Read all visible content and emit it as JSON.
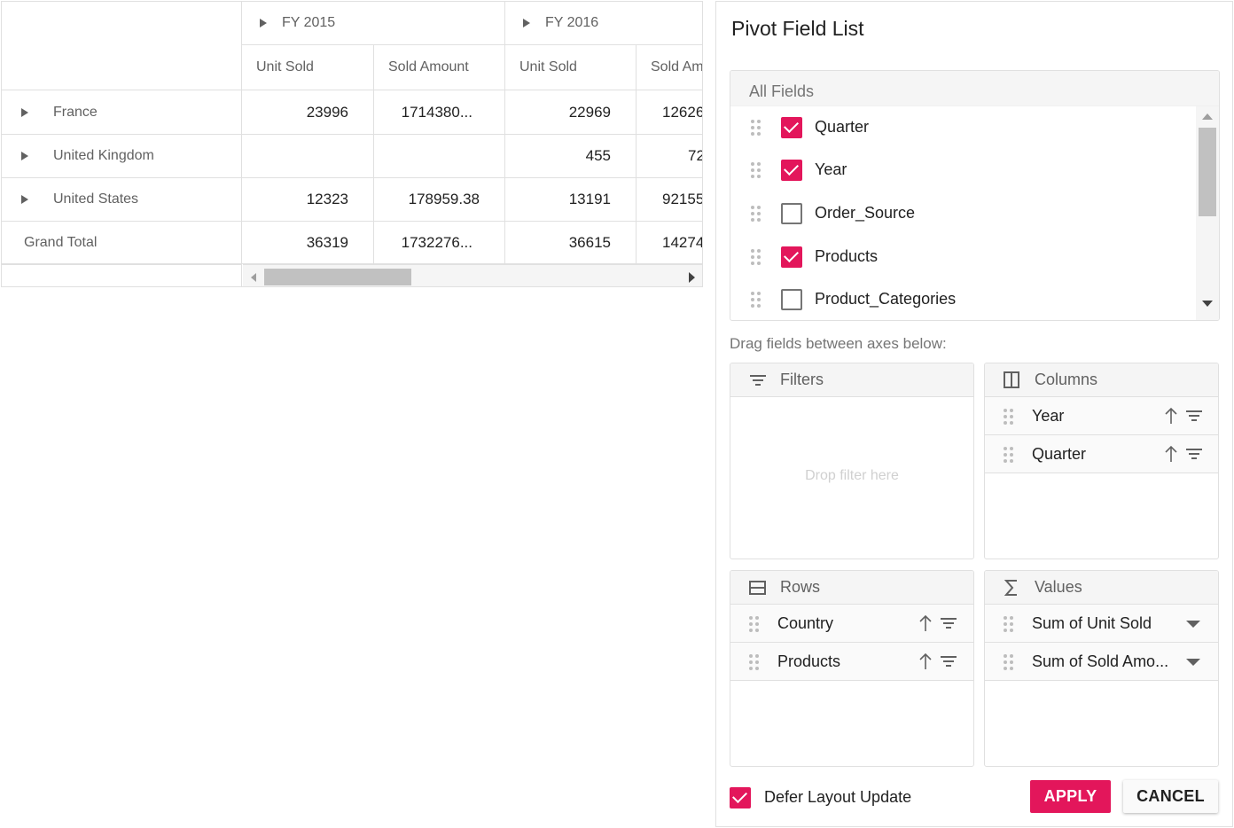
{
  "grid": {
    "column_groups": [
      {
        "label": "FY 2015"
      },
      {
        "label": "FY 2016"
      }
    ],
    "measures": [
      "Unit Sold",
      "Sold Amount",
      "Unit Sold",
      "Sold Am"
    ],
    "rows": [
      {
        "label": "France",
        "values": [
          "23996",
          "1714380...",
          "22969",
          "12626"
        ]
      },
      {
        "label": "United Kingdom",
        "values": [
          "",
          "",
          "455",
          "72"
        ]
      },
      {
        "label": "United States",
        "values": [
          "12323",
          "178959.38",
          "13191",
          "92155"
        ]
      },
      {
        "label": "Grand Total",
        "values": [
          "36319",
          "1732276...",
          "36615",
          "14274"
        ]
      }
    ]
  },
  "field_list": {
    "title": "Pivot Field List",
    "all_fields_header": "All Fields",
    "fields": [
      {
        "label": "Quarter",
        "checked": true
      },
      {
        "label": "Year",
        "checked": true
      },
      {
        "label": "Order_Source",
        "checked": false
      },
      {
        "label": "Products",
        "checked": true
      },
      {
        "label": "Product_Categories",
        "checked": false
      }
    ],
    "drag_hint": "Drag fields between axes below:",
    "filters": {
      "label": "Filters",
      "drop_hint": "Drop filter here",
      "icon": "filter-icon"
    },
    "columns": {
      "label": "Columns",
      "icon": "columns-icon",
      "items": [
        "Year",
        "Quarter"
      ]
    },
    "rows": {
      "label": "Rows",
      "icon": "rows-icon",
      "items": [
        "Country",
        "Products"
      ]
    },
    "values": {
      "label": "Values",
      "icon": "sigma-icon",
      "items": [
        "Sum of Unit Sold",
        "Sum of Sold Amo..."
      ]
    },
    "defer_label": "Defer Layout Update",
    "defer_checked": true,
    "apply_label": "APPLY",
    "cancel_label": "CANCEL",
    "accent_color": "#e3165b"
  }
}
